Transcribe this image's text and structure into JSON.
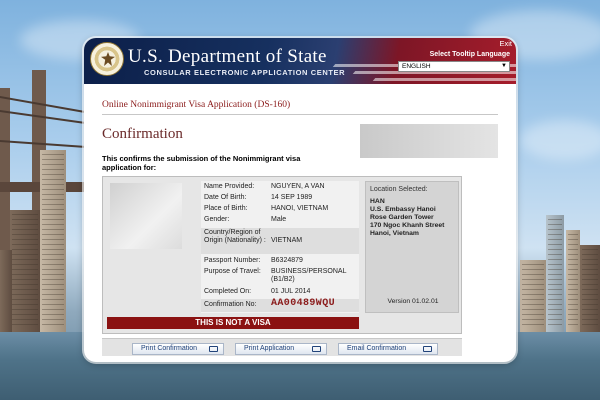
{
  "header": {
    "title": "U.S. Department of State",
    "subtitle": "CONSULAR ELECTRONIC APPLICATION CENTER",
    "exit_label": "Exit",
    "tooltip_language_label": "Select Tooltip Language",
    "language_selected": "ENGLISH"
  },
  "page": {
    "application_link": "Online Nonimmigrant Visa Application (DS-160)",
    "title": "Confirmation",
    "intro": "This confirms the submission of the Nonimmigrant visa application for:"
  },
  "applicant": {
    "fields": [
      {
        "label": "Name Provided:",
        "value": "NGUYEN, A VAN"
      },
      {
        "label": "Date Of Birth:",
        "value": "14 SEP 1989"
      },
      {
        "label": "Place of Birth:",
        "value": "HANOI, VIETNAM"
      },
      {
        "label": "Gender:",
        "value": "Male"
      },
      {
        "label": "Country/Region of Origin (Nationality) :",
        "value": "VIETNAM"
      },
      {
        "label": "Passport Number:",
        "value": "B6324879"
      },
      {
        "label": "Purpose of Travel:",
        "value": "BUSINESS/PERSONAL (B1/B2)"
      },
      {
        "label": "Completed On:",
        "value": "01 JUL 2014"
      },
      {
        "label": "Confirmation No:",
        "value": "AA00489WQU"
      }
    ],
    "banner": "THIS IS NOT A VISA"
  },
  "location": {
    "label": "Location Selected:",
    "lines": [
      "HAN",
      "U.S. Embassy Hanoi",
      "Rose Garden Tower",
      "170 Ngoc Khanh Street",
      "Hanoi, Vietnam"
    ],
    "version": "Version 01.02.01"
  },
  "buttons": {
    "print_confirmation": "Print Confirmation",
    "print_application": "Print Application",
    "email_confirmation": "Email Confirmation"
  }
}
